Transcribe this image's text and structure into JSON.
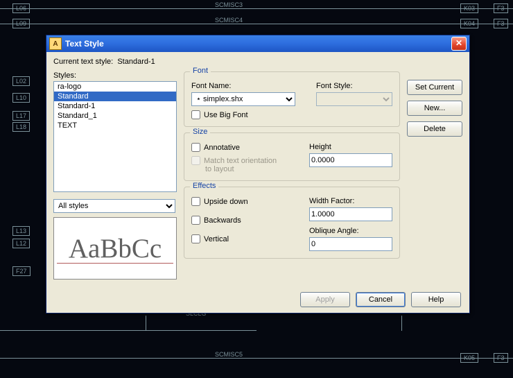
{
  "bg": {
    "sigs": {
      "misc3": "SCMISC3",
      "misc4": "SCMISC4",
      "misc5": "SCMISC5",
      "sleg": "SLCLG"
    },
    "ltags": [
      "L06",
      "L09",
      "L02",
      "L10",
      "L17",
      "L18",
      "L13",
      "L12",
      "F27"
    ],
    "rtags_k": [
      "K03",
      "K04",
      "K05"
    ],
    "rtags_f": [
      "F3",
      "F3",
      "F3"
    ]
  },
  "dialog": {
    "title": "Text Style",
    "currentStyleLabel": "Current text style:",
    "currentStyleValue": "Standard-1",
    "stylesLabel": "Styles:",
    "stylesItems": [
      "ra-logo",
      "Standard",
      "Standard-1",
      "Standard_1",
      "TEXT"
    ],
    "stylesSelected": "Standard",
    "filterOptions": [
      "All styles"
    ],
    "filterSelected": "All styles",
    "previewSample": "AaBbCc",
    "font": {
      "legend": "Font",
      "nameLabel": "Font Name:",
      "nameValue": "simplex.shx",
      "styleLabel": "Font Style:",
      "styleValue": "",
      "useBigFontLabel": "Use Big Font",
      "useBigFontChecked": false
    },
    "size": {
      "legend": "Size",
      "annotativeLabel": "Annotative",
      "annotativeChecked": false,
      "matchLabel1": "Match text orientation",
      "matchLabel2": "to layout",
      "heightLabel": "Height",
      "heightValue": "0.0000"
    },
    "effects": {
      "legend": "Effects",
      "upsideLabel": "Upside down",
      "upsideChecked": false,
      "backwardsLabel": "Backwards",
      "backwardsChecked": false,
      "verticalLabel": "Vertical",
      "verticalChecked": false,
      "widthLabel": "Width Factor:",
      "widthValue": "1.0000",
      "obliqueLabel": "Oblique Angle:",
      "obliqueValue": "0"
    },
    "buttons": {
      "setCurrent": "Set Current",
      "new": "New...",
      "delete": "Delete",
      "apply": "Apply",
      "cancel": "Cancel",
      "help": "Help"
    }
  }
}
